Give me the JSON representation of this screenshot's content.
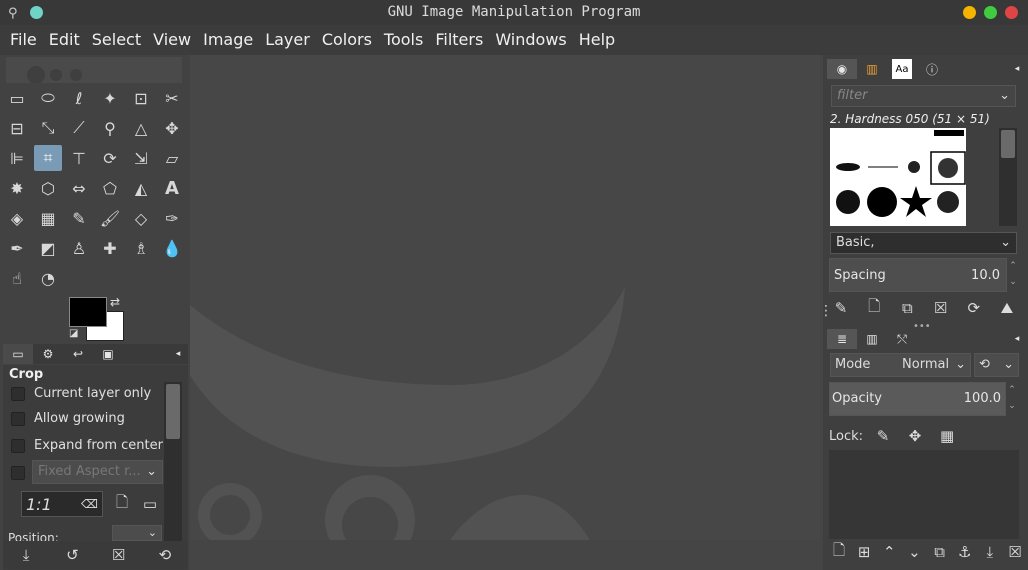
{
  "window": {
    "title": "GNU Image Manipulation Program"
  },
  "menu": [
    "File",
    "Edit",
    "Select",
    "View",
    "Image",
    "Layer",
    "Colors",
    "Tools",
    "Filters",
    "Windows",
    "Help"
  ],
  "tool_options": {
    "title": "Crop",
    "options": [
      {
        "label": "Current layer only"
      },
      {
        "label": "Allow growing"
      },
      {
        "label": "Expand from center"
      }
    ],
    "fixed_aspect_placeholder": "Fixed Aspect r...",
    "ratio_value": "1:1",
    "position_label": "Position:"
  },
  "brushes": {
    "filter_placeholder": "filter",
    "selected_brush": "2. Hardness 050 (51 × 51)",
    "tag_value": "Basic,",
    "spacing_label": "Spacing",
    "spacing_value": "10.0"
  },
  "layers": {
    "mode_label": "Mode",
    "mode_value": "Normal",
    "opacity_label": "Opacity",
    "opacity_value": "100.0",
    "lock_label": "Lock:"
  },
  "colors": {
    "accent": "#7a9bb5",
    "close": "#f4b400",
    "maximize": "#3fcc3f",
    "minimize": "#e04444",
    "fg": "#000000",
    "bg": "#ffffff"
  }
}
